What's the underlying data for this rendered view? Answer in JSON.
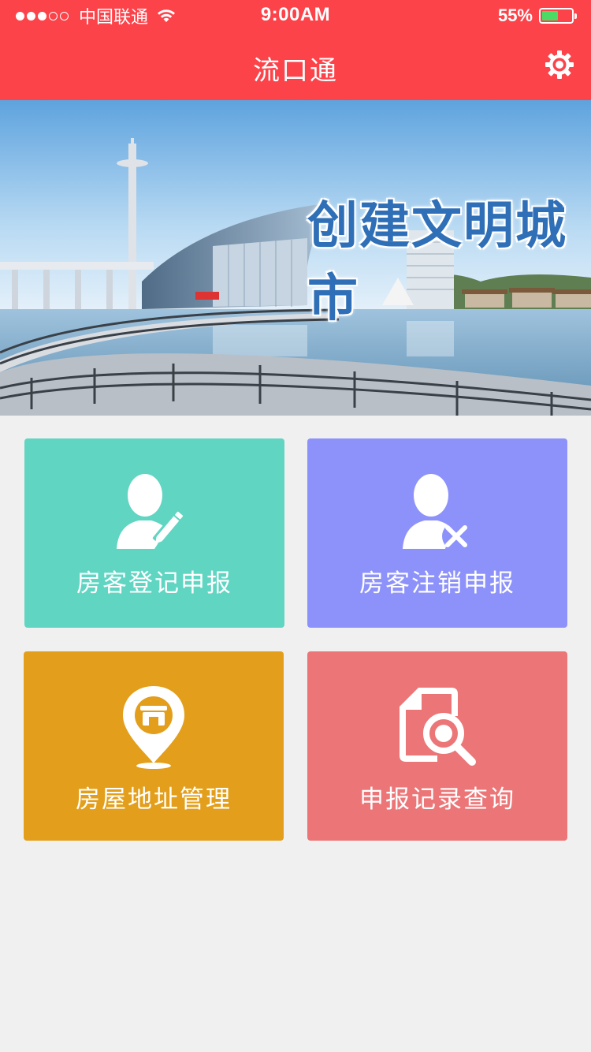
{
  "status_bar": {
    "carrier": "中国联通",
    "time": "9:00AM",
    "battery_percent": "55%",
    "battery_level": 0.55,
    "signal_bars_filled": 3,
    "signal_bars_total": 5
  },
  "nav": {
    "title": "流口通",
    "settings_icon": "gear-icon"
  },
  "banner": {
    "caption": "创建文明城市"
  },
  "tiles": [
    {
      "label": "房客登记申报",
      "icon": "user-edit-icon",
      "color": "#60d5c2"
    },
    {
      "label": "房客注销申报",
      "icon": "user-remove-icon",
      "color": "#8d92fa"
    },
    {
      "label": "房屋地址管理",
      "icon": "location-store-icon",
      "color": "#e39f1b"
    },
    {
      "label": "申报记录查询",
      "icon": "document-search-icon",
      "color": "#ec7577"
    }
  ],
  "colors": {
    "accent": "#fc434a",
    "background": "#f0f0f0"
  }
}
